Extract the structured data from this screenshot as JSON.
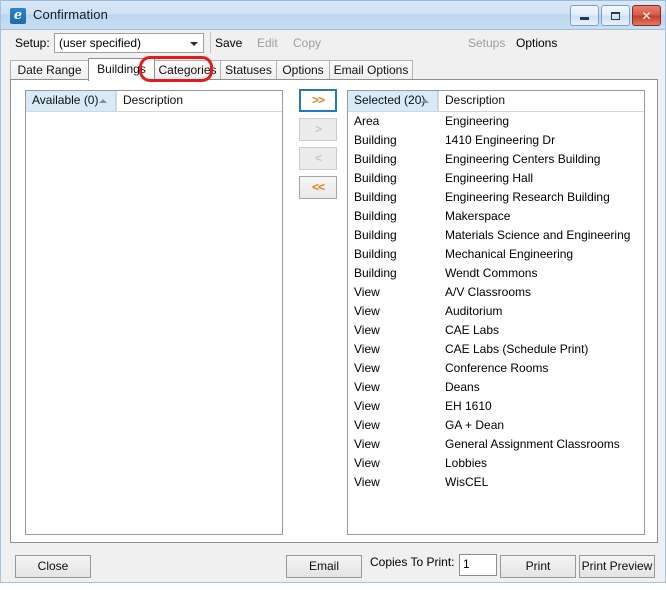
{
  "window": {
    "title": "Confirmation",
    "icon": "app-logo-icon",
    "minimize_label": "",
    "maximize_label": "",
    "close_label": "✕"
  },
  "toolbar": {
    "setup_label": "Setup:",
    "setup_value": "(user specified)",
    "setup_placeholder": "(user specified)",
    "save_label": "Save",
    "edit_label": "Edit",
    "copy_label": "Copy",
    "setups_label": "Setups",
    "options_label": "Options"
  },
  "tabs": [
    {
      "label": "Date Range",
      "active": false
    },
    {
      "label": "Buildings",
      "active": true
    },
    {
      "label": "Categories",
      "active": false
    },
    {
      "label": "Statuses",
      "active": false
    },
    {
      "label": "Options",
      "active": false
    },
    {
      "label": "Email Options",
      "active": false
    }
  ],
  "available_list": {
    "header_col1": "Available (0)",
    "header_col2": "Description",
    "rows": []
  },
  "transfer_buttons": [
    {
      "label": ">>",
      "name": "move-all-right-button",
      "state": "focused"
    },
    {
      "label": ">",
      "name": "move-right-button",
      "state": "disabled"
    },
    {
      "label": "<",
      "name": "move-left-button",
      "state": "disabled"
    },
    {
      "label": "<<",
      "name": "move-all-left-button",
      "state": "enabled"
    }
  ],
  "selected_list": {
    "header_col1": "Selected (20)",
    "header_col2": "Description",
    "sort_direction": "ascending",
    "rows": [
      {
        "type": "Area",
        "description": "Engineering"
      },
      {
        "type": "Building",
        "description": "1410 Engineering Dr"
      },
      {
        "type": "Building",
        "description": "Engineering Centers Building"
      },
      {
        "type": "Building",
        "description": "Engineering Hall"
      },
      {
        "type": "Building",
        "description": "Engineering Research Building"
      },
      {
        "type": "Building",
        "description": "Makerspace"
      },
      {
        "type": "Building",
        "description": "Materials Science and Engineering"
      },
      {
        "type": "Building",
        "description": "Mechanical Engineering"
      },
      {
        "type": "Building",
        "description": "Wendt Commons"
      },
      {
        "type": "View",
        "description": "A/V Classrooms"
      },
      {
        "type": "View",
        "description": "Auditorium"
      },
      {
        "type": "View",
        "description": "CAE Labs"
      },
      {
        "type": "View",
        "description": "CAE Labs (Schedule Print)"
      },
      {
        "type": "View",
        "description": "Conference Rooms"
      },
      {
        "type": "View",
        "description": "Deans"
      },
      {
        "type": "View",
        "description": "EH 1610"
      },
      {
        "type": "View",
        "description": "GA + Dean"
      },
      {
        "type": "View",
        "description": "General Assignment Classrooms"
      },
      {
        "type": "View",
        "description": "Lobbies"
      },
      {
        "type": "View",
        "description": "WisCEL"
      }
    ]
  },
  "footer": {
    "close_label": "Close",
    "email_label": "Email",
    "copies_label": "Copies To Print:",
    "copies_value": "1",
    "print_label": "Print",
    "print_preview_label": "Print Preview"
  },
  "annotation": {
    "target": "Categories",
    "color": "#e51c1c"
  }
}
